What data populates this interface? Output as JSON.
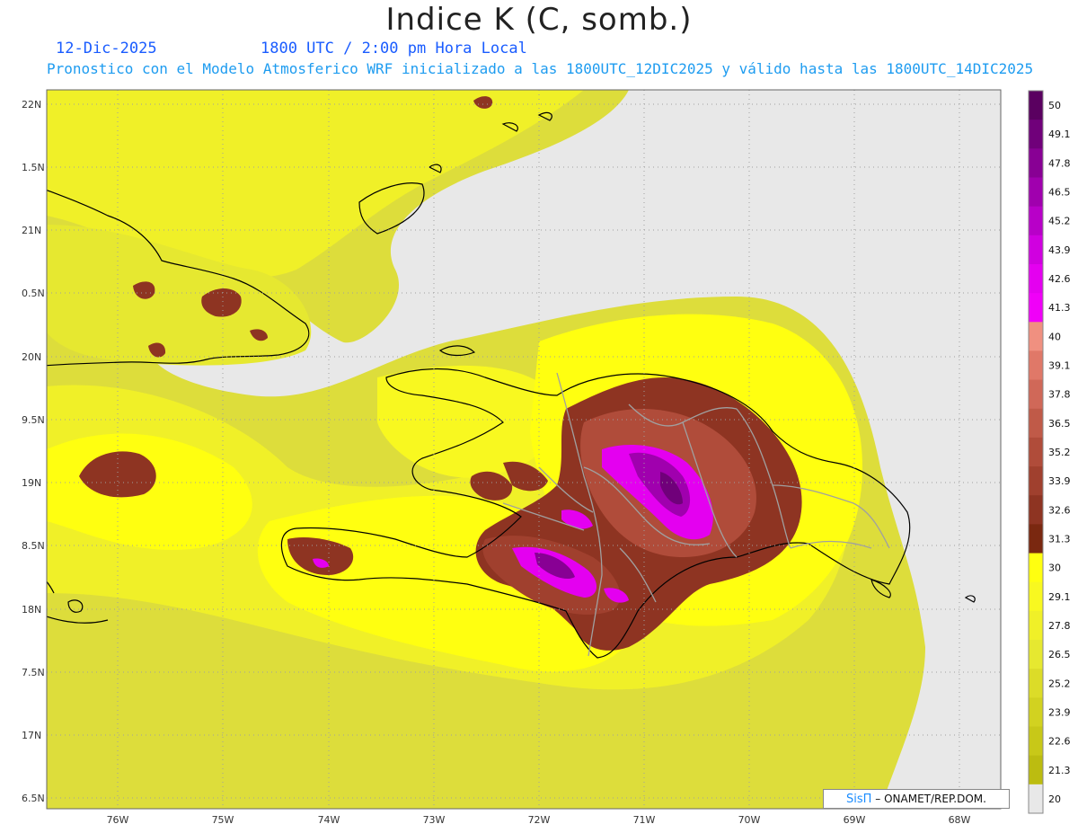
{
  "header": {
    "title": "Indice K (C, somb.)",
    "date": "12-Dic-2025",
    "time": "1800 UTC / 2:00 pm Hora Local",
    "description": "Pronostico con el Modelo Atmosferico WRF inicializado a las 1800UTC_12DIC2025 y válido hasta las  1800UTC_14DIC2025"
  },
  "map": {
    "lat_labels": [
      "22N",
      "1.5N",
      "21N",
      "0.5N",
      "20N",
      "9.5N",
      "19N",
      "8.5N",
      "18N",
      "7.5N",
      "17N",
      "6.5N"
    ],
    "lon_labels": [
      "76W",
      "75W",
      "74W",
      "73W",
      "72W",
      "71W",
      "70W",
      "69W",
      "68W"
    ],
    "background_color": "#e8e8e8",
    "coastline_color": "#000000",
    "province_border_color": "#a0a0a0",
    "grid": "dotted"
  },
  "colorbar": {
    "labels": [
      "50",
      "49.1",
      "47.8",
      "46.5",
      "45.2",
      "43.9",
      "42.6",
      "41.3",
      "40",
      "39.1",
      "37.8",
      "36.5",
      "35.2",
      "33.9",
      "32.6",
      "31.3",
      "30",
      "29.1",
      "27.8",
      "26.5",
      "25.2",
      "23.9",
      "22.6",
      "21.3",
      "20"
    ],
    "colors": [
      "#5a0060",
      "#70007a",
      "#880094",
      "#a000ae",
      "#b800c8",
      "#d000e0",
      "#e400f0",
      "#f000f8",
      "#f09080",
      "#e07868",
      "#d06858",
      "#c05a48",
      "#b04c3a",
      "#a0402e",
      "#8e3422",
      "#7a2810",
      "#ffff10",
      "#f8f820",
      "#f0f028",
      "#e6e830",
      "#dcdc28",
      "#d2d220",
      "#c8c818",
      "#bcbc10",
      "#e8e8e8"
    ]
  },
  "credit": {
    "brand": "SisΠ",
    "text": "– ONAMET/REP.DOM."
  }
}
